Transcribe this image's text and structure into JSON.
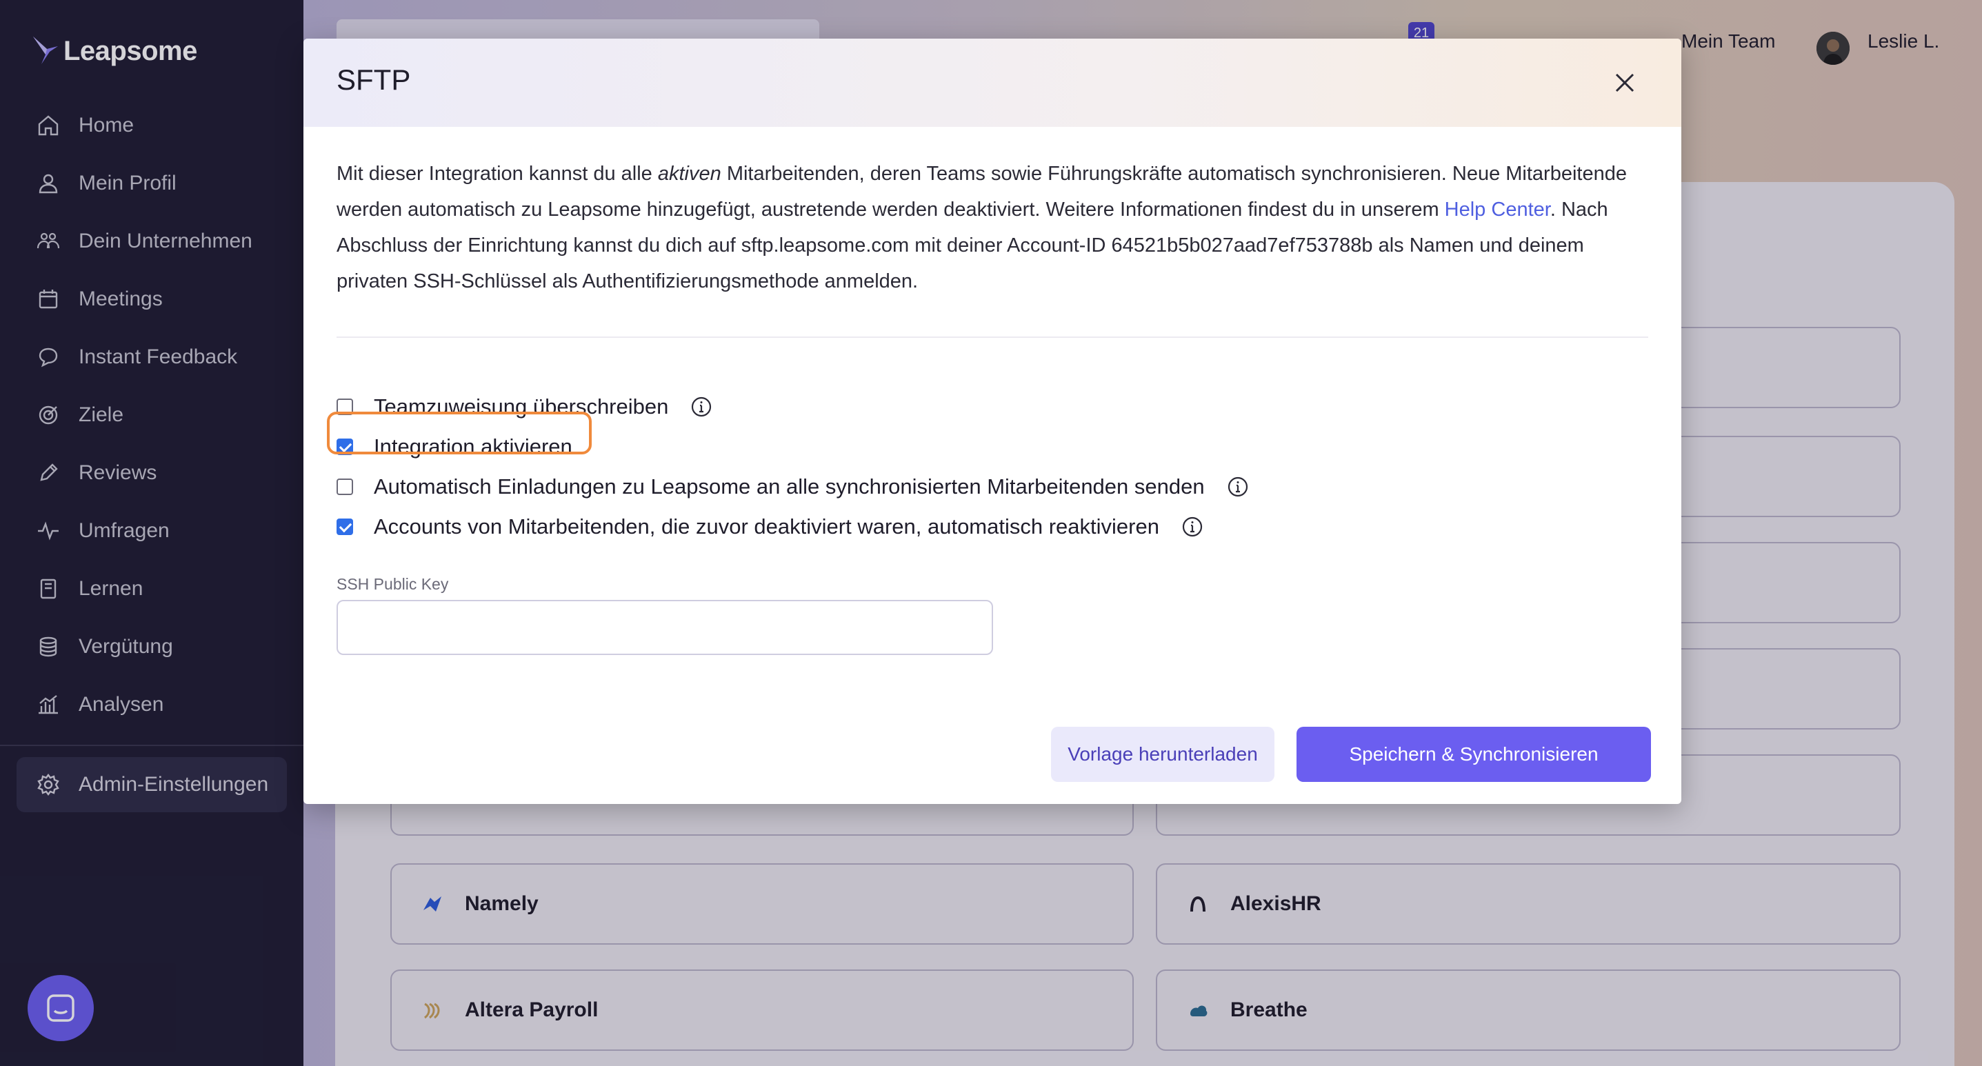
{
  "app": {
    "name": "Leapsome"
  },
  "sidebar": {
    "items": [
      {
        "label": "Home",
        "icon": "home-icon"
      },
      {
        "label": "Mein Profil",
        "icon": "user-icon"
      },
      {
        "label": "Dein Unternehmen",
        "icon": "people-icon"
      },
      {
        "label": "Meetings",
        "icon": "calendar-icon"
      },
      {
        "label": "Instant Feedback",
        "icon": "chat-bubble-icon"
      },
      {
        "label": "Ziele",
        "icon": "target-icon"
      },
      {
        "label": "Reviews",
        "icon": "pencil-icon"
      },
      {
        "label": "Umfragen",
        "icon": "pulse-icon"
      },
      {
        "label": "Lernen",
        "icon": "book-icon"
      },
      {
        "label": "Vergütung",
        "icon": "coins-icon"
      },
      {
        "label": "Analysen",
        "icon": "chart-icon"
      }
    ],
    "admin": {
      "label": "Admin-Einstellungen",
      "icon": "gear-icon"
    }
  },
  "header": {
    "notification_count": "21",
    "team_label": "Mein Team",
    "user_name": "Leslie L."
  },
  "background_tiles": [
    {
      "name": "Namely"
    },
    {
      "name": "AlexisHR"
    },
    {
      "name": "Altera Payroll"
    },
    {
      "name": "Breathe"
    }
  ],
  "modal": {
    "title": "SFTP",
    "description": {
      "part1": "Mit dieser Integration kannst du alle ",
      "emphasis": "aktiven",
      "part2": " Mitarbeitenden, deren Teams sowie Führungskräfte automatisch synchronisieren. Neue Mitarbeitende werden automatisch zu Leapsome hinzugefügt, austretende werden deaktiviert. Weitere Informationen findest du in unserem ",
      "link": "Help Center",
      "part3": ". Nach Abschluss der Einrichtung kannst du dich auf sftp.leapsome.com mit deiner Account-ID 64521b5b027aad7ef753788b als Namen und deinem privaten SSH-Schlüssel als Authentifizierungsmethode anmelden."
    },
    "options": [
      {
        "label": "Teamzuweisung überschreiben",
        "checked": false,
        "info": true
      },
      {
        "label": "Integration aktivieren",
        "checked": true,
        "info": false
      },
      {
        "label": "Automatisch Einladungen zu Leapsome an alle synchronisierten Mitarbeitenden senden",
        "checked": false,
        "info": true
      },
      {
        "label": "Accounts von Mitarbeitenden, die zuvor deaktiviert waren, automatisch reaktivieren",
        "checked": true,
        "info": true
      }
    ],
    "ssh_label": "SSH Public Key",
    "ssh_value": "",
    "download_label": "Vorlage herunterladen",
    "save_label": "Speichern & Synchronisieren"
  },
  "colors": {
    "sidebar_bg": "#1f1d33",
    "accent": "#6b5ef0",
    "highlight": "#f08a3c",
    "link": "#4f5fe0"
  }
}
